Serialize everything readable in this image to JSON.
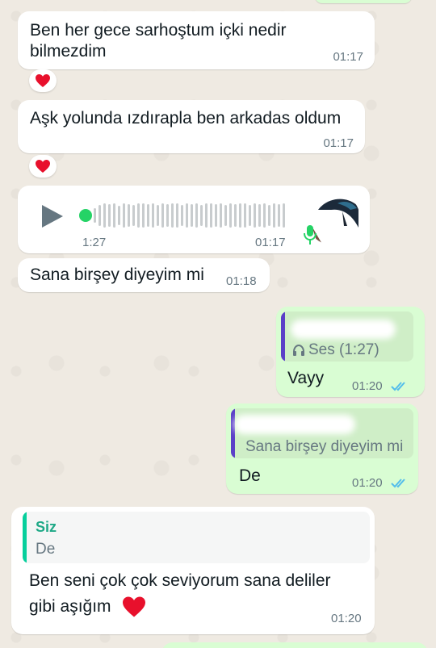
{
  "messages": [
    {
      "id": "m1",
      "direction": "incoming",
      "lines": [
        "Ben her gece sarhoştum içki nedir",
        "bilmezdim"
      ],
      "time": "01:17",
      "reaction": "heart"
    },
    {
      "id": "m2",
      "direction": "incoming",
      "lines": [
        "Aşk yolunda ızdırapla ben arkadas oldum"
      ],
      "time": "01:17",
      "reaction": "heart"
    },
    {
      "id": "m3",
      "direction": "incoming",
      "type": "voice",
      "duration": "1:27",
      "time": "01:17",
      "progress": 0
    },
    {
      "id": "m4",
      "direction": "incoming",
      "lines": [
        "Sana birşey diyeyim mi"
      ],
      "time": "01:18"
    },
    {
      "id": "m5",
      "direction": "outgoing",
      "reply": {
        "text": "Ses (1:27)",
        "icon": "headphones-icon"
      },
      "lines": [
        "Vayy"
      ],
      "time": "01:20",
      "status": "read"
    },
    {
      "id": "m6",
      "direction": "outgoing",
      "reply": {
        "text": "Sana birşey diyeyim mi"
      },
      "lines": [
        "De"
      ],
      "time": "01:20",
      "status": "read"
    },
    {
      "id": "m7",
      "direction": "incoming",
      "reply": {
        "name": "Siz",
        "text": "De"
      },
      "lines": [
        "Ben seni çok çok seviyorum sana deliler",
        "gibi aşığım"
      ],
      "emoji": "heart",
      "time": "01:20"
    }
  ],
  "colors": {
    "incoming_bubble": "#ffffff",
    "outgoing_bubble": "#d9fdd3",
    "accent_green": "#25d366",
    "quote_bar_purple": "#5b3fc8",
    "quote_bar_teal": "#06cf9c",
    "quote_name_teal": "#1fa987",
    "read_ticks": "#53bdeb",
    "heart": "#e8102c"
  }
}
